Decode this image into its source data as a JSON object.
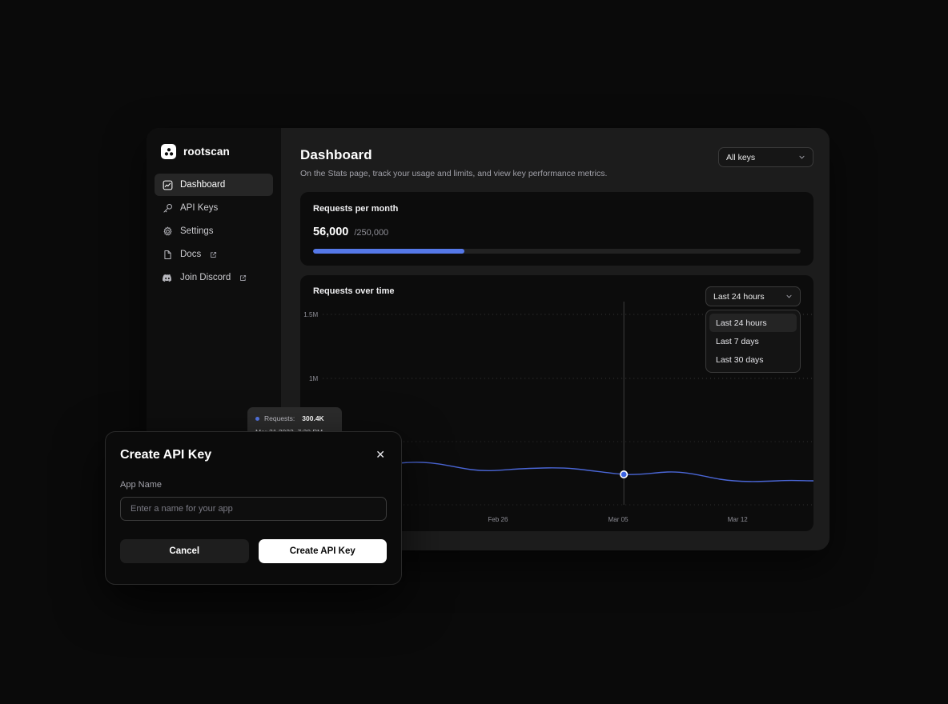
{
  "brand": {
    "name": "rootscan",
    "logo_icon": "rootscan-logo-icon"
  },
  "sidebar": {
    "items": [
      {
        "label": "Dashboard",
        "icon": "chart-line-icon",
        "active": true,
        "external": false
      },
      {
        "label": "API Keys",
        "icon": "key-icon",
        "active": false,
        "external": false
      },
      {
        "label": "Settings",
        "icon": "gear-icon",
        "active": false,
        "external": false
      },
      {
        "label": "Docs",
        "icon": "document-icon",
        "active": false,
        "external": true
      },
      {
        "label": "Join Discord",
        "icon": "discord-icon",
        "active": false,
        "external": true
      }
    ]
  },
  "header": {
    "title": "Dashboard",
    "subtitle": "On the Stats page, track your usage and limits, and view key performance metrics.",
    "keys_select": {
      "value": "All keys",
      "chevron_icon": "chevron-down-icon"
    }
  },
  "usage_card": {
    "title": "Requests per month",
    "value": "56,000",
    "limit": "/250,000",
    "percent": 31
  },
  "chart_card": {
    "title": "Requests over time",
    "range_select": {
      "value": "Last 24 hours",
      "chevron_icon": "chevron-down-icon"
    },
    "dropdown": {
      "open": true,
      "options": [
        {
          "label": "Last 24 hours",
          "selected": true
        },
        {
          "label": "Last 7 days",
          "selected": false
        },
        {
          "label": "Last 30 days",
          "selected": false
        }
      ]
    },
    "tooltip": {
      "series_label": "Requests:",
      "series_value": "300.4K",
      "timestamp": "Mar 31 2023, 7:30 PM"
    }
  },
  "chart_data": {
    "type": "line",
    "title": "Requests over time",
    "xlabel": "",
    "ylabel": "",
    "ylim": [
      0,
      1700000
    ],
    "ytick_labels": [
      "1.5M",
      "1M"
    ],
    "ytick_values": [
      1500000,
      1000000
    ],
    "xtick_labels": [
      "Feb 26",
      "Mar 05",
      "Mar 12"
    ],
    "grid": "dotted-horizontal",
    "legend": "none",
    "line_color": "#4a66d6",
    "series": [
      {
        "name": "Requests",
        "x": [
          "Feb 19",
          "Feb 20",
          "Feb 21",
          "Feb 22",
          "Feb 23",
          "Feb 24",
          "Feb 25",
          "Feb 26",
          "Feb 27",
          "Feb 28",
          "Mar 01",
          "Mar 02",
          "Mar 03",
          "Mar 04",
          "Mar 05",
          "Mar 06",
          "Mar 07",
          "Mar 08",
          "Mar 09",
          "Mar 10",
          "Mar 11",
          "Mar 12",
          "Mar 13",
          "Mar 14",
          "Mar 15"
        ],
        "values": [
          320000,
          330000,
          340000,
          345000,
          335000,
          320000,
          312000,
          318000,
          322000,
          315000,
          308000,
          300000,
          305000,
          308000,
          300400,
          302000,
          308000,
          305000,
          292000,
          288000,
          285000,
          287000,
          286000,
          288000,
          289000
        ]
      }
    ],
    "highlight_point": {
      "x": "Mar 31 2023, 7:30 PM",
      "y": 300400,
      "label": "300.4K"
    }
  },
  "modal": {
    "title": "Create API Key",
    "close_icon": "close-icon",
    "field_label": "App Name",
    "field_value": "",
    "field_placeholder": "Enter a name for your app",
    "cancel_label": "Cancel",
    "submit_label": "Create API Key"
  },
  "colors": {
    "accent_blue": "#5578e8",
    "line_blue": "#4a66d6",
    "window_bg": "#1c1c1c",
    "card_bg": "#0c0c0c",
    "sidebar_bg": "#0e0e0e",
    "page_bg": "#0a0a0a"
  }
}
